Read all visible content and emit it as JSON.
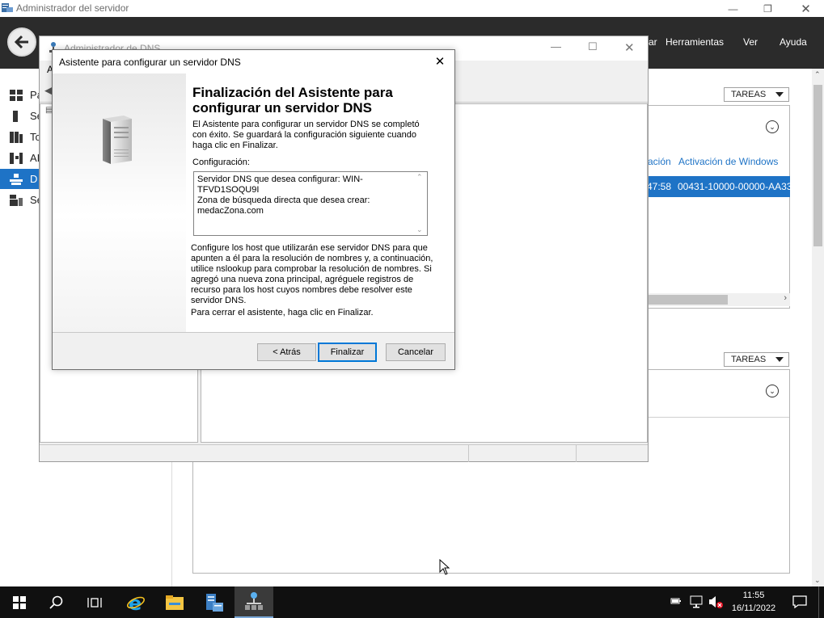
{
  "server_manager": {
    "title": "Administrador del servidor",
    "menu": {
      "manage": "ar",
      "tools": "Herramientas",
      "view": "Ver",
      "help": "Ayuda"
    },
    "sidebar": [
      {
        "label": "Pa",
        "icon": "dashboard-icon"
      },
      {
        "label": "Se",
        "icon": "local-server-icon"
      },
      {
        "label": "To",
        "icon": "all-servers-icon"
      },
      {
        "label": "AI",
        "icon": "ad-ds-icon"
      },
      {
        "label": "D",
        "icon": "dns-icon",
        "active": true
      },
      {
        "label": "Se",
        "icon": "file-services-icon"
      }
    ],
    "tasks_label_1": "TAREAS",
    "tasks_label_2": "TAREAS",
    "table": {
      "col_partial": "ación",
      "col_activation": "Activación de Windows",
      "row_time": "47:58",
      "row_activation": "00431-10000-00000-AA33"
    }
  },
  "dns_manager": {
    "title": "Administrador de DNS",
    "menu_partial": "A"
  },
  "wizard": {
    "title": "Asistente para configurar un servidor DNS",
    "heading": "Finalización del Asistente para configurar un servidor DNS",
    "intro": "El Asistente para configurar un servidor DNS se completó con éxito. Se guardará la configuración siguiente cuando haga clic en Finalizar.",
    "config_label": "Configuración:",
    "config_lines": [
      "Servidor DNS que desea configurar: WIN-",
      "TFVD1SOQU9I",
      "Zona de búsqueda directa que desea crear:",
      "medacZona.com"
    ],
    "instructions": "Configure los host que utilizarán ese servidor DNS para que apunten a él para la resolución de nombres y, a continuación, utilice nslookup para comprobar la resolución de nombres. Si agregó una nueva zona principal, agréguele registros de recurso para los host cuyos nombres debe resolver este servidor DNS.",
    "close_hint": "Para cerrar el asistente, haga clic en Finalizar.",
    "buttons": {
      "back": "< Atrás",
      "finish": "Finalizar",
      "cancel": "Cancelar"
    }
  },
  "taskbar": {
    "time": "11:55",
    "date": "16/11/2022",
    "icons": [
      "windows-start-icon",
      "search-icon",
      "task-view-icon",
      "internet-explorer-icon",
      "file-explorer-icon",
      "server-manager-icon",
      "dns-manager-icon"
    ]
  },
  "colors": {
    "header_bg": "#2b2b2b",
    "accent": "#1e73c6",
    "button_focus": "#0078d7",
    "taskbar_bg": "#101010"
  }
}
